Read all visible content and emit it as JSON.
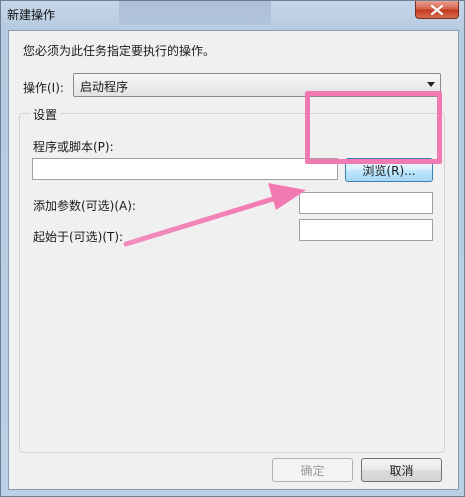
{
  "window": {
    "title": "新建操作",
    "close_icon": "close-icon",
    "close_color": "#c2391f"
  },
  "dialog": {
    "instruction": "您必须为此任务指定要执行的操作。",
    "action_label": "操作(I):",
    "action_value": "启动程序",
    "settings_label": "设置",
    "program_label": "程序或脚本(P):",
    "program_value": "",
    "browse_label": "浏览(R)...",
    "args_label": "添加参数(可选)(A):",
    "args_value": "",
    "start_in_label": "起始于(可选)(T):",
    "start_in_value": "",
    "ok_label": "确定",
    "cancel_label": "取消"
  },
  "annotation": {
    "highlight_color": "#f27ab3",
    "arrow_color": "#f27ab3"
  }
}
